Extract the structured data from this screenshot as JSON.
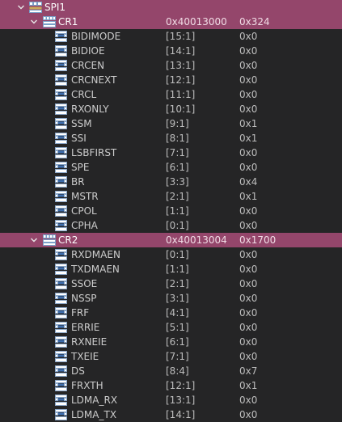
{
  "peripheral": {
    "name": "SPI1",
    "icon": "peripheral-icon"
  },
  "registers": [
    {
      "name": "CR1",
      "address": "0x40013000",
      "value": "0x324",
      "fields": [
        {
          "name": "BIDIMODE",
          "bits": "[15:1]",
          "value": "0x0"
        },
        {
          "name": "BIDIOE",
          "bits": "[14:1]",
          "value": "0x0"
        },
        {
          "name": "CRCEN",
          "bits": "[13:1]",
          "value": "0x0"
        },
        {
          "name": "CRCNEXT",
          "bits": "[12:1]",
          "value": "0x0"
        },
        {
          "name": "CRCL",
          "bits": "[11:1]",
          "value": "0x0"
        },
        {
          "name": "RXONLY",
          "bits": "[10:1]",
          "value": "0x0"
        },
        {
          "name": "SSM",
          "bits": "[9:1]",
          "value": "0x1"
        },
        {
          "name": "SSI",
          "bits": "[8:1]",
          "value": "0x1"
        },
        {
          "name": "LSBFIRST",
          "bits": "[7:1]",
          "value": "0x0"
        },
        {
          "name": "SPE",
          "bits": "[6:1]",
          "value": "0x0"
        },
        {
          "name": "BR",
          "bits": "[3:3]",
          "value": "0x4"
        },
        {
          "name": "MSTR",
          "bits": "[2:1]",
          "value": "0x1"
        },
        {
          "name": "CPOL",
          "bits": "[1:1]",
          "value": "0x0"
        },
        {
          "name": "CPHA",
          "bits": "[0:1]",
          "value": "0x0"
        }
      ]
    },
    {
      "name": "CR2",
      "address": "0x40013004",
      "value": "0x1700",
      "fields": [
        {
          "name": "RXDMAEN",
          "bits": "[0:1]",
          "value": "0x0"
        },
        {
          "name": "TXDMAEN",
          "bits": "[1:1]",
          "value": "0x0"
        },
        {
          "name": "SSOE",
          "bits": "[2:1]",
          "value": "0x0"
        },
        {
          "name": "NSSP",
          "bits": "[3:1]",
          "value": "0x0"
        },
        {
          "name": "FRF",
          "bits": "[4:1]",
          "value": "0x0"
        },
        {
          "name": "ERRIE",
          "bits": "[5:1]",
          "value": "0x0"
        },
        {
          "name": "RXNEIE",
          "bits": "[6:1]",
          "value": "0x0"
        },
        {
          "name": "TXEIE",
          "bits": "[7:1]",
          "value": "0x0"
        },
        {
          "name": "DS",
          "bits": "[8:4]",
          "value": "0x7"
        },
        {
          "name": "FRXTH",
          "bits": "[12:1]",
          "value": "0x1"
        },
        {
          "name": "LDMA_RX",
          "bits": "[13:1]",
          "value": "0x0"
        },
        {
          "name": "LDMA_TX",
          "bits": "[14:1]",
          "value": "0x0"
        }
      ]
    }
  ],
  "icons": {
    "chevron": "chevron-down-icon",
    "register": "register-icon",
    "field": "field-icon"
  },
  "colors": {
    "background": "#252526",
    "selected_row": "#94466b",
    "text": "#cccccc"
  }
}
